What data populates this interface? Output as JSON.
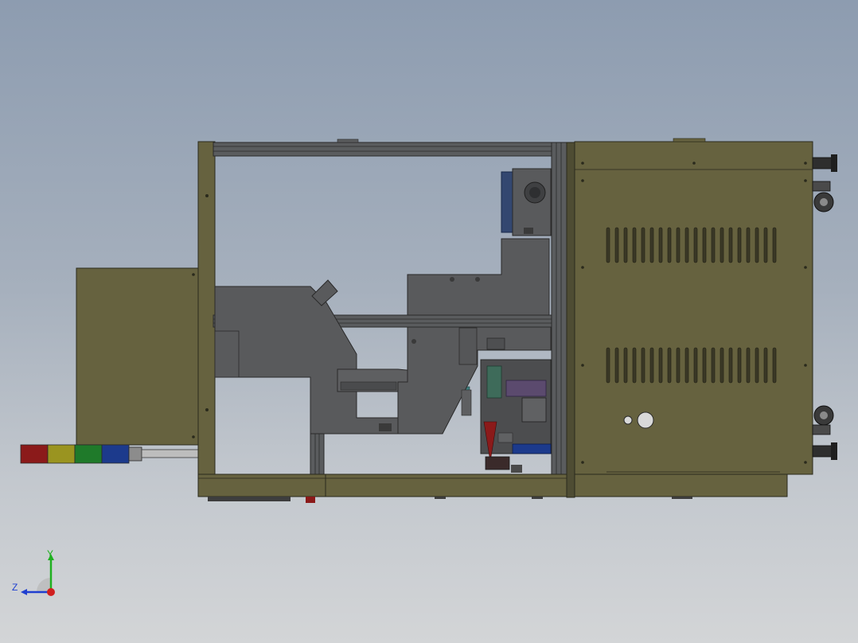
{
  "view": {
    "kind": "3d-cad-viewport",
    "background_top": "#8d9cb0",
    "background_bottom": "#d3d5d7"
  },
  "model": {
    "frame_color": "#5c5a3c",
    "cabinet_color": "#66623f",
    "profile_color": "#5a5c5e",
    "machine_grey": "#595a5c",
    "tower_light_colors": [
      "#8b1a1a",
      "#9a9420",
      "#1f7a2a",
      "#1c3a8c",
      "#8c8c8c"
    ]
  },
  "triad": {
    "y_label": "Y",
    "z_label": "Z",
    "y_color": "#1fb01f",
    "z_color": "#1f3fd0",
    "x_color": "#d01f1f"
  }
}
